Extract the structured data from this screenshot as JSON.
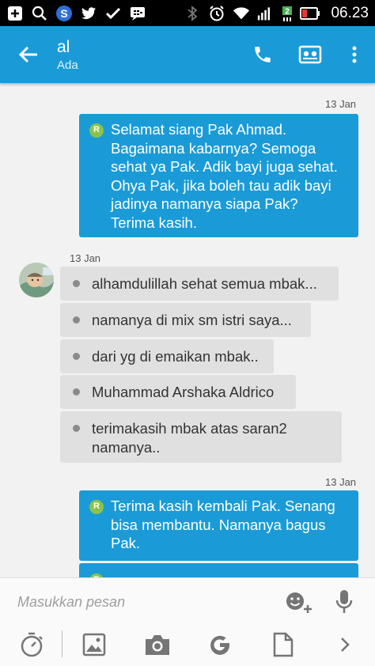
{
  "status_bar": {
    "time": "06.23",
    "icons": [
      "plus-box-icon",
      "search-icon",
      "s-app-icon",
      "twitter-icon",
      "check-icon",
      "bbm-icon",
      "bluetooth-icon",
      "alarm-icon",
      "wifi-icon",
      "signal-icon",
      "sim-icon",
      "battery-icon"
    ],
    "sim_label": "2"
  },
  "header": {
    "title": "al",
    "subtitle": "Ada",
    "actions": [
      "call-icon",
      "contact-card-icon",
      "overflow-menu-icon"
    ]
  },
  "conversation": {
    "blocks": [
      {
        "date": "13 Jan",
        "direction": "outgoing",
        "badge": "R",
        "text": "Selamat siang Pak Ahmad.\nBagaimana kabarnya? Semoga\nsehat ya Pak. Adik bayi juga sehat.\nOhya Pak, jika boleh tau adik bayi\njadinya namanya siapa Pak?\nTerima kasih."
      },
      {
        "date": "13 Jan",
        "direction": "incoming",
        "messages": [
          "alhamdulillah sehat semua mbak...",
          "namanya di mix sm istri saya...",
          "dari yg di emaikan mbak..",
          "Muhammad Arshaka Aldrico",
          "terimakasih mbak atas saran2\nnamanya.."
        ]
      },
      {
        "date": "13 Jan",
        "direction": "outgoing",
        "badge": "R",
        "text": "Terima kasih kembali Pak. Senang\nbisa membantu. Namanya bagus\nPak."
      }
    ]
  },
  "composer": {
    "placeholder": "Masukkan pesan",
    "icons": [
      "emoji-add-icon",
      "mic-icon"
    ],
    "toolbar": [
      "timer-icon",
      "image-icon",
      "camera-icon",
      "google-icon",
      "document-icon",
      "chevron-right-icon"
    ]
  },
  "colors": {
    "accent": "#1a9bd7",
    "incoming_bubble": "#e0e0e0",
    "badge": "#8bc34a"
  }
}
